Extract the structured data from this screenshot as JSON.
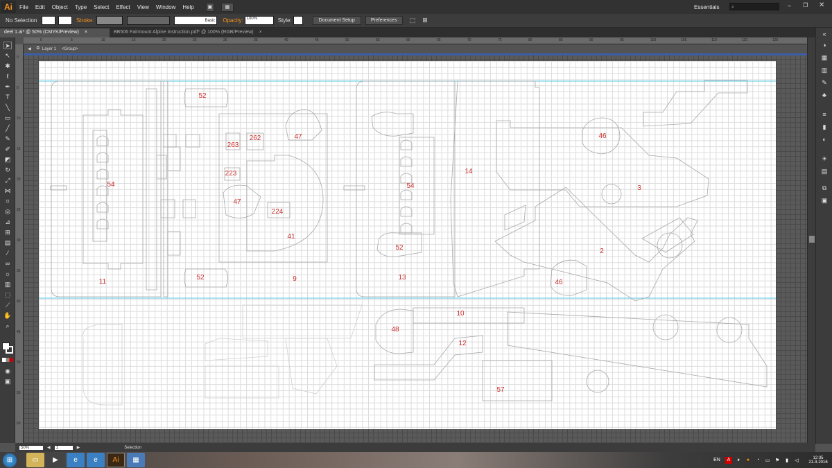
{
  "app": {
    "logo": "Ai",
    "workspace": "Essentials"
  },
  "menu": [
    "File",
    "Edit",
    "Object",
    "Type",
    "Select",
    "Effect",
    "View",
    "Window",
    "Help"
  ],
  "control_bar": {
    "selection": "No Selection",
    "stroke_label": "Stroke:",
    "brush_label": "Basic",
    "opacity_label": "Opacity:",
    "opacity_value": "100%",
    "style_label": "Style:",
    "doc_setup": "Document Setup",
    "preferences": "Preferences"
  },
  "tabs": [
    {
      "label": "deel 1.ai* @ 50% (CMYK/Preview)",
      "close": "×"
    },
    {
      "label": "BB506 Fairmount Alpine Instruction.pdf* @ 100% (RGB/Preview)",
      "close": "×"
    }
  ],
  "breadcrumb": {
    "layer": "Layer 1",
    "group": "<Group>"
  },
  "ruler_top": [
    "0",
    "5",
    "10",
    "15",
    "20",
    "25",
    "30",
    "35",
    "40",
    "45",
    "50",
    "55",
    "60",
    "65",
    "70",
    "75",
    "80",
    "85",
    "90",
    "95",
    "100",
    "105",
    "110",
    "115",
    "120"
  ],
  "ruler_left": [
    "0",
    "5",
    "10",
    "15",
    "20",
    "25",
    "30",
    "35",
    "40",
    "45",
    "50",
    "55",
    "60"
  ],
  "part_labels": [
    "52",
    "263",
    "262",
    "47",
    "223",
    "54",
    "47",
    "224",
    "41",
    "11",
    "52",
    "9",
    "54",
    "52",
    "13",
    "14",
    "46",
    "3",
    "2",
    "46",
    "10",
    "48",
    "12",
    "57"
  ],
  "status": {
    "zoom": "50%",
    "artboard": "1",
    "tool": "Selection"
  },
  "taskbar": {
    "language": "EN",
    "time": "12:35",
    "date": "21-3-2016"
  },
  "colors": {
    "accent": "#f7941d",
    "guide": "#56c8e6",
    "label": "#c9302c"
  }
}
